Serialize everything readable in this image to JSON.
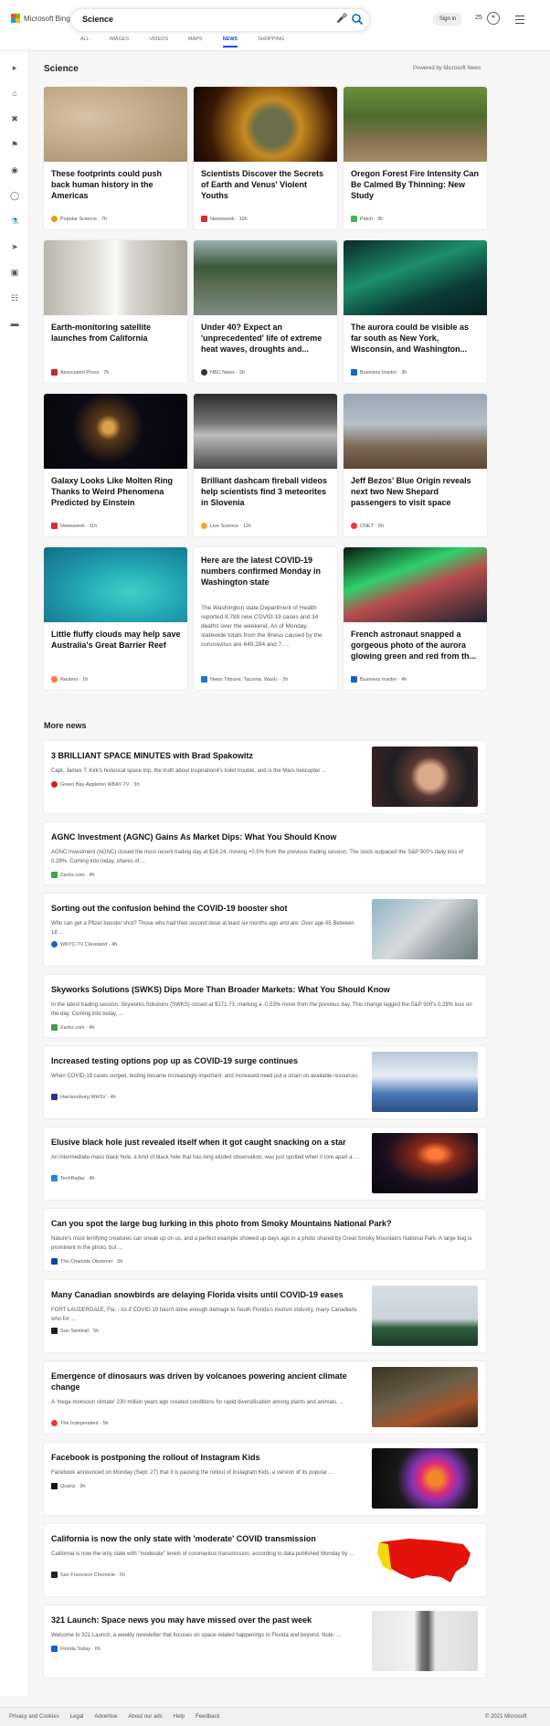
{
  "brand": {
    "name": "Microsoft Bing"
  },
  "search": {
    "query": "Science"
  },
  "tabs": [
    "ALL",
    "IMAGES",
    "VIDEOS",
    "MAPS",
    "NEWS",
    "SHOPPING"
  ],
  "header": {
    "signin": "Sign in",
    "rewards": "25"
  },
  "section": {
    "title": "Science",
    "powered": "Powered by Microsoft News"
  },
  "cards": [
    {
      "title": "These footprints could push back human history in the Americas",
      "source": "Popular Science · 7h"
    },
    {
      "title": "Scientists Discover the Secrets of Earth and Venus' Violent Youths",
      "source": "Newsweek · 10h"
    },
    {
      "title": "Oregon Forest Fire Intensity Can Be Calmed By Thinning: New Study",
      "source": "Patch · 3h"
    },
    {
      "title": "Earth-monitoring satellite launches from California",
      "source": "Associated Press · 7h"
    },
    {
      "title": "Under 40? Expect an 'unprecedented' life of extreme heat waves, droughts and...",
      "source": "NBC News · 2h"
    },
    {
      "title": "The aurora could be visible as far south as New York, Wisconsin, and Washington...",
      "source": "Business Insider · 3h"
    },
    {
      "title": "Galaxy Looks Like Molten Ring Thanks to Weird Phenomena Predicted by Einstein",
      "source": "Newsweek · 11h"
    },
    {
      "title": "Brilliant dashcam fireball videos help scientists find 3 meteorites in Slovenia",
      "source": "Live Science · 11h"
    },
    {
      "title": "Jeff Bezos' Blue Origin reveals next two New Shepard passengers to visit space",
      "source": "CNET · 5h"
    },
    {
      "title": "Little fluffy clouds may help save Australia's Great Barrier Reef",
      "source": "Reuters · 1h"
    },
    {
      "title": "Here are the latest COVID-19 numbers confirmed Monday in Washington state",
      "desc": "The Washington state Department of Health reported 8,788 new COVID-19 cases and 34 deaths over the weekend. As of Monday, statewide totals from the illness caused by the coronavirus are 649,284 and 7, ...",
      "source": "News Tribune, Tacoma, Wash. · 2h"
    },
    {
      "title": "French astronaut snapped a gorgeous photo of the aurora glowing green and red from th...",
      "source": "Business Insider · 4h"
    }
  ],
  "more": {
    "title": "More news"
  },
  "news": [
    {
      "title": "3 BRILLIANT SPACE MINUTES with Brad Spakowitz",
      "snippet": "Capt. James T. Kirk's historical space trip, the truth about Inspiration4's toilet trouble, and is the Mars helicopter ...",
      "source": "Green Bay-Appleton WBAY-TV · 3h"
    },
    {
      "title": "AGNC Investment (AGNC) Gains As Market Dips: What You Should Know",
      "snippet": "AGNC Investment (AGNC) closed the most recent trading day at $16.24, moving +0.5% from the previous trading session. The stock outpaced the S&P 500's daily loss of 0.28%. Coming into today, shares of ...",
      "source": "Zacks.com · 4h"
    },
    {
      "title": "Sorting out the confusion behind the COVID-19 booster shot",
      "snippet": "Who can get a Pfizer booster shot? Those who had their second dose at least six months ago and are: Over age 65 Between 18 ...",
      "source": "WKYC-TV Cleveland · 4h"
    },
    {
      "title": "Skyworks Solutions (SWKS) Dips More Than Broader Markets: What You Should Know",
      "snippet": "In the latest trading session, Skyworks Solutions (SWKS) closed at $171.73, marking a -0.53% move from the previous day. This change lagged the S&P 500's 0.28% loss on the day. Coming into today, ...",
      "source": "Zacks.com · 4h"
    },
    {
      "title": "Increased testing options pop up as COVID-19 surge continues",
      "snippet": "When COVID-19 cases surged, testing became increasingly important, and increased need put a strain on available resources.",
      "source": "Harrisonburg WHSV · 4h"
    },
    {
      "title": "Elusive black hole just revealed itself when it got caught snacking on a star",
      "snippet": "An intermediate-mass black hole, a kind of black hole that has long eluded observation, was just spotted when it tore apart a ...",
      "source": "TechRadar · 4h"
    },
    {
      "title": "Can you spot the large bug lurking in this photo from Smoky Mountains National Park?",
      "snippet": "Nature's most terrifying creatures can sneak up on us, and a perfect example showed up days ago in a photo shared by Great Smoky Mountains National Park. A large bug is prominent in the photo, but ...",
      "source": "The Charlotte Observer · 5h"
    },
    {
      "title": "Many Canadian snowbirds are delaying Florida visits until COVID-19 eases",
      "snippet": "FORT LAUDERDALE, Fla. - As if COVID-19 hasn't done enough damage to South Florida's tourism industry, many Canadians who for ...",
      "source": "Sun Sentinel · 5h"
    },
    {
      "title": "Emergence of dinosaurs was driven by volcanoes powering ancient climate change",
      "snippet": "A 'mega-monsoon climate' 230 million years ago created conditions for rapid diversification among plants and animals, ...",
      "source": "The Independent · 5h"
    },
    {
      "title": "Facebook is postponing the rollout of Instagram Kids",
      "snippet": "Facebook announced on Monday (Sept. 27) that it is pausing the rollout of Instagram Kids, a version of its popular ...",
      "source": "Quartz · 9h"
    },
    {
      "title": "California is now the only state with 'moderate' COVID transmission",
      "snippet": "California is now the only state with \"moderate\" levels of coronavirus transmission, according to data published Monday by ...",
      "source": "San Francisco Chronicle · 5h"
    },
    {
      "title": "321 Launch: Space news you may have missed over the past week",
      "snippet": "Welcome to 321 Launch, a weekly newsletter that focuses on space-related happenings in Florida and beyond. Note: ...",
      "source": "Florida Today · 6h"
    }
  ],
  "footer": {
    "links": [
      "Privacy and Cookies",
      "Legal",
      "Advertise",
      "About our ads",
      "Help",
      "Feedback"
    ],
    "copyright": "© 2021 Microsoft"
  }
}
